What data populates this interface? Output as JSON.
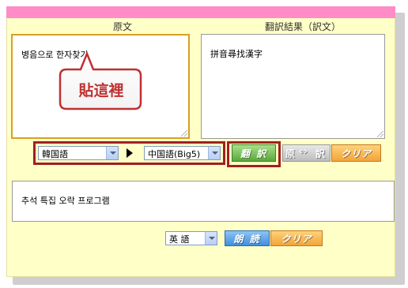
{
  "labels": {
    "source": "原文",
    "result": "翻訳結果（訳文）"
  },
  "source_text": "병음으로 한자찾기",
  "result_text": "拼音尋找漢字",
  "callout": "貼這裡",
  "from_language": "韓国語",
  "to_language": "中国語(Big5)",
  "buttons": {
    "translate": "翻 訳",
    "swap_left": "原",
    "swap_right": "訳",
    "clear": "クリア",
    "read_aloud": "朗 読",
    "clear2": "クリア"
  },
  "lower_text": "추석 특집 오락 프로그램",
  "voice_language": "英 語",
  "colors": {
    "accent_pink": "#ff8cc6",
    "panel_bg": "#ffffc8",
    "translate_green": "#5aa83a",
    "clear_orange": "#f2a43a",
    "read_blue": "#3f8fe0",
    "callout_red": "#c03030"
  }
}
